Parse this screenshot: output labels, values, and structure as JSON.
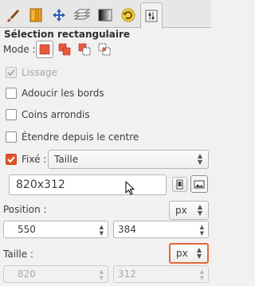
{
  "tabs": [
    {
      "icon": "paintbrush-icon"
    },
    {
      "icon": "gradient-palette-icon"
    },
    {
      "icon": "move-arrows-icon"
    },
    {
      "icon": "layers-icon"
    },
    {
      "icon": "gradient-icon"
    },
    {
      "icon": "undo-history-icon"
    },
    {
      "icon": "tool-options-icon",
      "active": true
    }
  ],
  "heading": "Sélection rectangulaire",
  "mode": {
    "label": "Mode :",
    "buttons": [
      {
        "icon": "replace-selection-icon",
        "active": true
      },
      {
        "icon": "add-selection-icon"
      },
      {
        "icon": "subtract-selection-icon"
      },
      {
        "icon": "intersect-selection-icon"
      }
    ]
  },
  "options": {
    "lissage": "Lissage",
    "adoucir": "Adoucir les bords",
    "coins": "Coins arrondis",
    "etendre": "Étendre depuis le centre"
  },
  "fixed": {
    "label": "Fixé :",
    "checked": true,
    "combo_value": "Taille",
    "ratio_value": "820x312"
  },
  "position": {
    "label": "Position :",
    "unit": "px",
    "x": "550",
    "y": "384"
  },
  "size": {
    "label": "Taille :",
    "unit": "px",
    "w": "820",
    "h": "312"
  },
  "colors": {
    "accent": "#e55126",
    "focus_border": "#e0683d"
  }
}
